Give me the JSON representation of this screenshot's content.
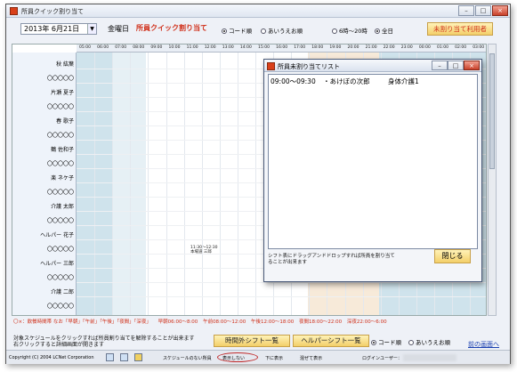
{
  "window": {
    "title": "所員クイック割り当て"
  },
  "toolbar": {
    "date": "2013年 6月21日",
    "weekday": "金曜日",
    "quick_label": "所員クイック割り当て",
    "sort_code": "コード順",
    "sort_kana": "あいうえお順",
    "range_day": "6時〜20時",
    "range_all": "全日",
    "unassigned_button": "未割り当て利用者"
  },
  "hours": [
    "05:00",
    "06:00",
    "07:00",
    "08:00",
    "09:00",
    "10:00",
    "11:00",
    "12:00",
    "13:00",
    "14:00",
    "15:00",
    "16:00",
    "17:00",
    "18:00",
    "19:00",
    "20:00",
    "21:00",
    "22:00",
    "23:00",
    "00:00",
    "01:00",
    "02:00",
    "03:00",
    "04:00"
  ],
  "staff": [
    "秋 紘葉",
    "〇〇〇〇〇",
    "片瀬 夏子",
    "〇〇〇〇〇",
    "春 歌子",
    "〇〇〇〇〇",
    "鶴 佐和子",
    "〇〇〇〇〇",
    "楽 ネケ子",
    "〇〇〇〇〇",
    "介護 太郎",
    "〇〇〇〇〇",
    "ヘルパー 花子",
    "〇〇〇〇〇",
    "ヘルパー 三郎",
    "〇〇〇〇〇",
    "介護 二郎",
    "〇〇〇〇〇"
  ],
  "event": {
    "time": "11:30〜12:30",
    "name": "本場道 三郎"
  },
  "legend": {
    "note": "〇×：飲餐時間帯 なお「早朝」「午前」「午後」「夜間」「深夜」",
    "early": "早朝06:00〜8:00",
    "morning": "午前08:00〜12:00",
    "afternoon": "午後12:00〜18:00",
    "night": "夜間18:00〜22:00",
    "late": "深夜22:00〜6:00"
  },
  "bottom": {
    "note_line1": "対象スケジュールをクリックすれば所員割り当てを解除することが出来ます",
    "note_line2": "右クリックすると詳細画面が開きます",
    "offhours_button": "時間外シフト一覧",
    "helper_button": "ヘルパーシフト一覧",
    "sort_code": "コード順",
    "sort_kana": "あいうえお順",
    "main_screen_link": "前の画面へ"
  },
  "status": {
    "copyright": "Copyright (C) 2004 LCNet Corporation",
    "no_schedule": "スケジュールのない所員",
    "hide": "表示しない",
    "show_below": "下に表示",
    "show_mixed": "混ぜて表示",
    "login_user": "ログインユーザー："
  },
  "popup": {
    "title": "所員未割り当てリスト",
    "row_time": "09:00〜09:30",
    "row_client": "・あけぼの次郎",
    "row_care": "身体介護1",
    "hint_line1": "シフト表にドラッグアンドドロップすれば所員を割り当て",
    "hint_line2": "ることが出来ます",
    "close_button": "閉じる"
  },
  "colors": {
    "accent_red": "#d0301a",
    "button_yellow": "#f3cf69",
    "band_blue": "#cfe3ec",
    "band_peach": "#f7ead9",
    "link_blue": "#1a3fb0"
  }
}
